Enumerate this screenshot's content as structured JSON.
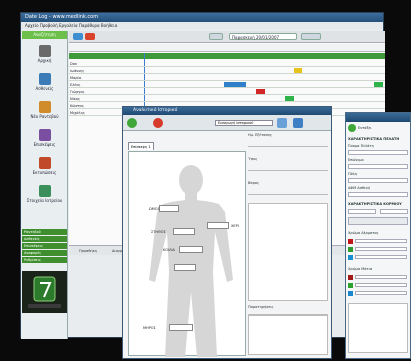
{
  "back_window": {
    "title": "Date Log - www.medlink.com",
    "menu": "Αρχείο  Προβολή  Εργαλεία  Παράθυρα  Βοήθεια",
    "sidebar_header": "Αναζήτηση",
    "sidebar_items": [
      "Αρχική",
      "Ασθενείς",
      "Νέο Ραντεβού",
      "Επισκέψεις",
      "Εκτυπώσεις",
      "Στοιχεία Ιατρείου"
    ],
    "green_bars": [
      "Ραντεβού",
      "Ασθενείς",
      "Επισκέψεις",
      "Αναφορές",
      "Ρυθμίσεις"
    ],
    "toolbar_date": "Παρασκευή 20/01/2007",
    "rows": [
      "Dan",
      "Ιωάννης",
      "Μαρία",
      "Ελένη",
      "Γιώργος",
      "Νίκος",
      "Κώστας",
      "Μιχάλης"
    ],
    "footer_labels": [
      "Προσθήκη",
      "Διαγραφή"
    ]
  },
  "front_window": {
    "title": "Αναλυτικό Ιστορικό",
    "tab": "Επίσκεψη 1",
    "toolbar_label": "Εισαγωγή Ιστορικού",
    "fields": [
      "Ημ. Εξέτασης",
      "Ύψος",
      "Βάρος",
      "Παρατηρήσεις"
    ],
    "body_labels": [
      "ΩΜΟΣ",
      "ΣΤΗΘΟΣ",
      "ΚΟΙΛΙΑ",
      "ΧΕΡΙ",
      "ΜΗΡΟΣ"
    ]
  },
  "right_window": {
    "title": "Προσθήκη Ασθενή",
    "heading": "ΧΑΡΑΚΤΗΡΙΣΤΙΚΑ ΠΕΛΑΤΗ",
    "fields": [
      "Όνομα Πελάτη",
      "Επώνυμο",
      "Πόλη",
      "ΑΦΜ Ασθενή"
    ],
    "section2": "ΧΑΡΑΚΤΗΡΙΣΤΙΚΑ ΚΟΡΜΙΟΥ",
    "section3": "Χρώμα Δέρματος",
    "section4": "Χρώμα Μάτια",
    "ok_label": "Εντάξει",
    "colors": [
      "#c01818",
      "#2e9b2e",
      "#1a8fcf",
      "#a01a1a",
      "#2ea02e",
      "#1a86d0"
    ]
  }
}
